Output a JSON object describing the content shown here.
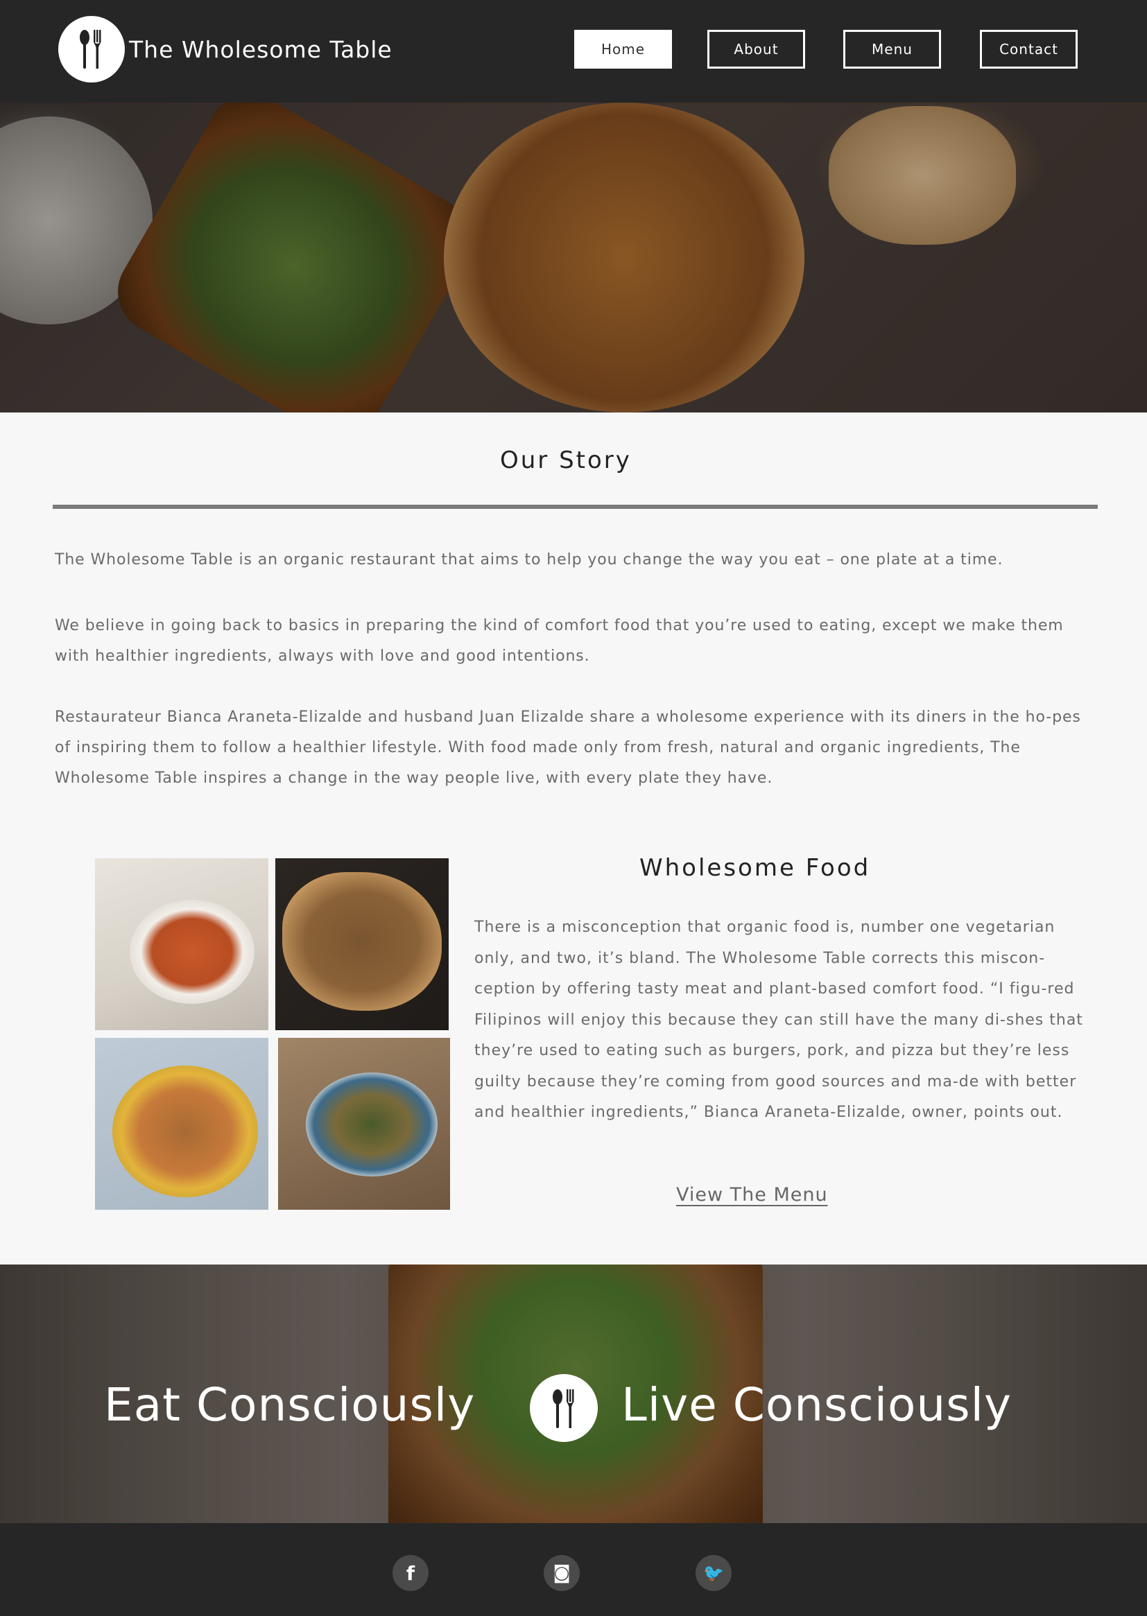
{
  "header": {
    "brand": "The Wholesome Table",
    "nav": [
      {
        "label": "Home",
        "active": true
      },
      {
        "label": "About",
        "active": false
      },
      {
        "label": "Menu",
        "active": false
      },
      {
        "label": "Contact",
        "active": false
      }
    ],
    "logo_icon": "fork-spoon-icon"
  },
  "story": {
    "title": "Our Story",
    "paragraphs": [
      "The Wholesome Table is an organic restaurant that aims to help you change the way you eat – one plate at a time.",
      "We believe in going back to basics in preparing the kind of comfort food that you’re used to eating, except we make them with healthier ingredients, always with love and good intentions.",
      "Restaurateur Bianca Araneta-Elizalde and husband Juan Elizalde share a wholesome experience with its diners in the ho-pes of inspiring them to follow a healthier lifestyle. With food made only from fresh, natural and organic ingredients, The Wholesome Table inspires a change in the way people live, with every plate they have."
    ]
  },
  "food": {
    "title": "Wholesome Food",
    "text": "There is a misconception that organic food is, number one vegetarian only, and two, it’s bland. The Wholesome Table corrects this miscon-ception by offering tasty meat and plant-based comfort food. “I figu-red Filipinos will enjoy this because they can still have the many di-shes that they’re used to eating such as burgers, pork, and pizza but they’re less guilty because they’re coming from good sources and ma-de with better and healthier ingredients,” Bianca Araneta-Elizalde, owner, points out.",
    "link": "View The Menu"
  },
  "banner": {
    "left": "Eat Consciously",
    "right": "Live Consciously"
  },
  "footer": {
    "social": [
      {
        "icon": "facebook-icon",
        "glyph": "f"
      },
      {
        "icon": "instagram-icon",
        "glyph": "◙"
      },
      {
        "icon": "twitter-icon",
        "glyph": "🐦"
      }
    ]
  },
  "colors": {
    "header_bg": "#262626",
    "page_bg": "#f7f7f7",
    "rule": "#7b7b7b"
  }
}
